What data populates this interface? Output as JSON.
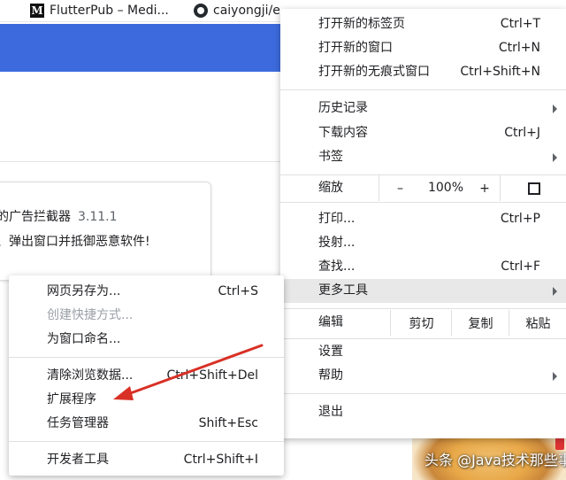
{
  "bookmarks": [
    {
      "label": "FlutterPub – Medi...",
      "icon": "medium-icon"
    },
    {
      "label": "caiyongji/e",
      "icon": "github-icon"
    }
  ],
  "extension_card": {
    "name_fragment": "的广告拦截器",
    "version": "3.11.1",
    "desc_fragment": "、弹出窗口并抵御恶意软件!"
  },
  "main_menu": {
    "new_tab": {
      "label": "打开新的标签页",
      "shortcut": "Ctrl+T"
    },
    "new_window": {
      "label": "打开新的窗口",
      "shortcut": "Ctrl+N"
    },
    "incognito": {
      "label": "打开新的无痕式窗口",
      "shortcut": "Ctrl+Shift+N"
    },
    "history": {
      "label": "历史记录"
    },
    "downloads": {
      "label": "下载内容",
      "shortcut": "Ctrl+J"
    },
    "bookmarks": {
      "label": "书签"
    },
    "zoom": {
      "label": "缩放",
      "minus": "–",
      "value": "100%",
      "plus": "+"
    },
    "print": {
      "label": "打印...",
      "shortcut": "Ctrl+P"
    },
    "cast": {
      "label": "投射..."
    },
    "find": {
      "label": "查找...",
      "shortcut": "Ctrl+F"
    },
    "more_tools": {
      "label": "更多工具"
    },
    "edit": {
      "label": "编辑",
      "cut": "剪切",
      "copy": "复制",
      "paste": "粘贴"
    },
    "settings": {
      "label": "设置"
    },
    "help": {
      "label": "帮助"
    },
    "exit": {
      "label": "退出"
    }
  },
  "sub_menu": {
    "save_page": {
      "label": "网页另存为...",
      "shortcut": "Ctrl+S"
    },
    "create_shortcut": {
      "label": "创建快捷方式..."
    },
    "name_window": {
      "label": "为窗口命名..."
    },
    "clear_data": {
      "label": "清除浏览数据...",
      "shortcut": "Ctrl+Shift+Del"
    },
    "extensions": {
      "label": "扩展程序"
    },
    "task_manager": {
      "label": "任务管理器",
      "shortcut": "Shift+Esc"
    },
    "dev_tools": {
      "label": "开发者工具",
      "shortcut": "Ctrl+Shift+I"
    }
  },
  "watermark": "头条 @Java技术那些事",
  "colors": {
    "accent_band": "#3d6bde",
    "arrow": "#d93025"
  }
}
